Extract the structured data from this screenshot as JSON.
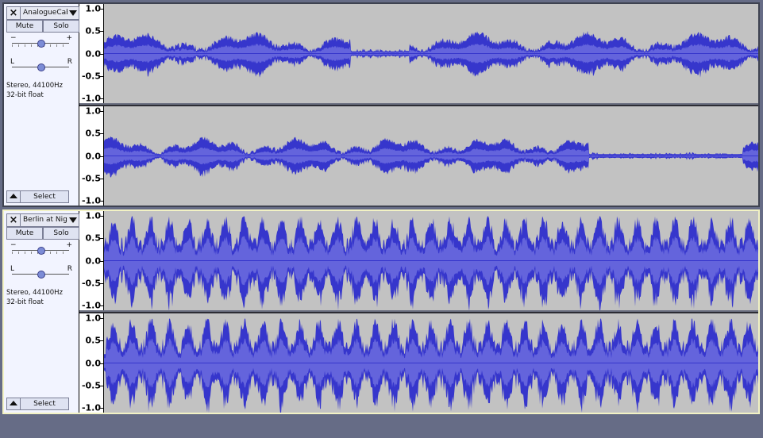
{
  "tracks": [
    {
      "name": "AnalogueCabin",
      "mute_label": "Mute",
      "solo_label": "Solo",
      "gain_minus": "−",
      "gain_plus": "+",
      "pan_left": "L",
      "pan_right": "R",
      "info_rate": "Stereo, 44100Hz",
      "info_format": "32-bit float",
      "select_label": "Select",
      "selected": false,
      "channels": [
        {
          "ticks": [
            "1.0",
            "0.5",
            "0.0",
            "-0.5",
            "-1.0"
          ]
        },
        {
          "ticks": [
            "1.0",
            "0.5",
            "0.0",
            "-0.5",
            "-1.0"
          ]
        }
      ]
    },
    {
      "name": "Berlin at Night",
      "mute_label": "Mute",
      "solo_label": "Solo",
      "gain_minus": "−",
      "gain_plus": "+",
      "pan_left": "L",
      "pan_right": "R",
      "info_rate": "Stereo, 44100Hz",
      "info_format": "32-bit float",
      "select_label": "Select",
      "selected": true,
      "channels": [
        {
          "ticks": [
            "1.0",
            "0.5",
            "0.0",
            "-0.5",
            "-1.0"
          ]
        },
        {
          "ticks": [
            "1.0",
            "0.5",
            "0.0",
            "-0.5",
            "-1.0"
          ]
        }
      ]
    }
  ],
  "colors": {
    "waveform_peak": "#3636cc",
    "waveform_rms": "#6464dc",
    "wave_background": "#c2c2c2",
    "selected_track_border": "#f2f2c4"
  }
}
